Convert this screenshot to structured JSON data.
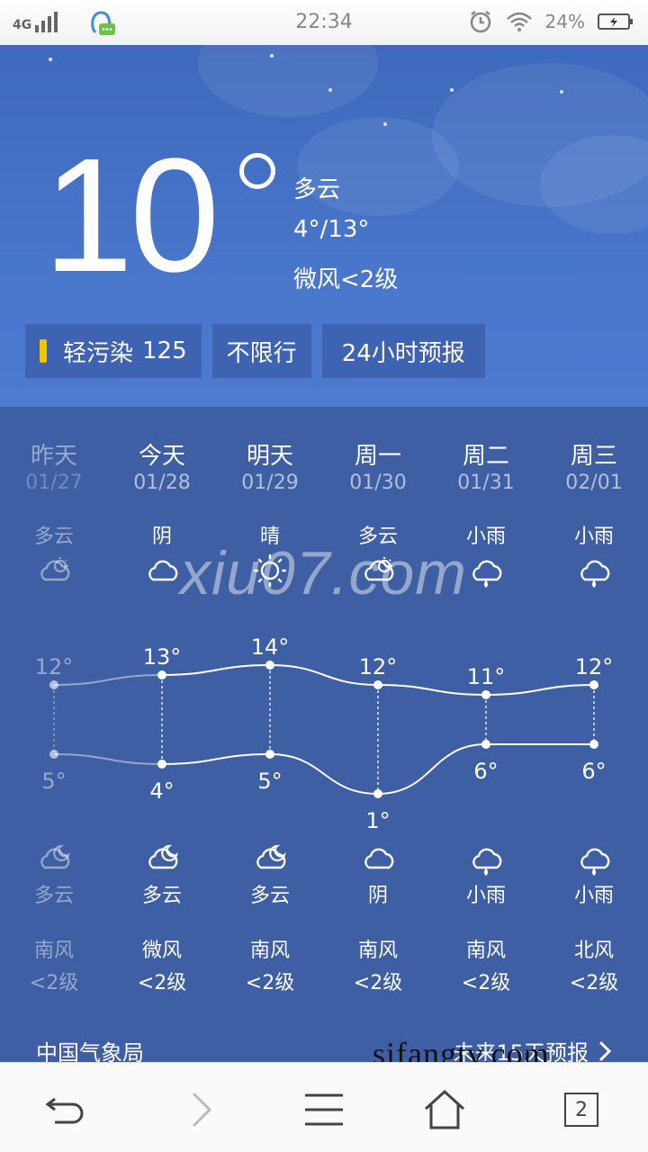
{
  "status_bar": {
    "network": "4G",
    "time": "22:34",
    "battery": "24%"
  },
  "current": {
    "temperature": "10",
    "condition": "多云",
    "range": "4°/13°",
    "wind": "微风<2级"
  },
  "pills": {
    "aqi_label": "轻污染",
    "aqi_value": "125",
    "traffic": "不限行",
    "hourly": "24小时预报"
  },
  "days": [
    {
      "name": "昨天",
      "date": "01/27",
      "day_cond": "多云",
      "day_icon": "partly-cloudy-icon",
      "high": "12°",
      "low": "5°",
      "night_cond": "多云",
      "night_icon": "cloudy-night-icon",
      "wind_dir": "南风",
      "wind_lvl": "<2级"
    },
    {
      "name": "今天",
      "date": "01/28",
      "day_cond": "阴",
      "day_icon": "cloud-icon",
      "high": "13°",
      "low": "4°",
      "night_cond": "多云",
      "night_icon": "cloudy-night-icon",
      "wind_dir": "微风",
      "wind_lvl": "<2级"
    },
    {
      "name": "明天",
      "date": "01/29",
      "day_cond": "晴",
      "day_icon": "sun-icon",
      "high": "14°",
      "low": "5°",
      "night_cond": "多云",
      "night_icon": "cloudy-night-icon",
      "wind_dir": "南风",
      "wind_lvl": "<2级"
    },
    {
      "name": "周一",
      "date": "01/30",
      "day_cond": "多云",
      "day_icon": "partly-cloudy-icon",
      "high": "12°",
      "low": "1°",
      "night_cond": "阴",
      "night_icon": "cloud-icon",
      "wind_dir": "南风",
      "wind_lvl": "<2级"
    },
    {
      "name": "周二",
      "date": "01/31",
      "day_cond": "小雨",
      "day_icon": "rain-icon",
      "high": "11°",
      "low": "6°",
      "night_cond": "小雨",
      "night_icon": "rain-icon",
      "wind_dir": "南风",
      "wind_lvl": "<2级"
    },
    {
      "name": "周三",
      "date": "02/01",
      "day_cond": "小雨",
      "day_icon": "rain-icon",
      "high": "12°",
      "low": "6°",
      "night_cond": "小雨",
      "night_icon": "rain-icon",
      "wind_dir": "北风",
      "wind_lvl": "<2级"
    }
  ],
  "chart_data": {
    "type": "line",
    "categories": [
      "昨天",
      "今天",
      "明天",
      "周一",
      "周二",
      "周三"
    ],
    "series": [
      {
        "values": [
          12,
          13,
          14,
          12,
          11,
          12
        ]
      },
      {
        "values": [
          5,
          4,
          5,
          1,
          6,
          6
        ]
      }
    ]
  },
  "footer": {
    "source": "中国气象局",
    "more": "未来15天预报"
  },
  "watermarks": {
    "center": "xiu07.com",
    "bottom": "sifangtv.com"
  },
  "navbar": {
    "tab_count": "2"
  },
  "colors": {
    "aqi_bar": "#f2c400",
    "panel": "#3e5fa3",
    "hero_top": "#3e69bc"
  }
}
